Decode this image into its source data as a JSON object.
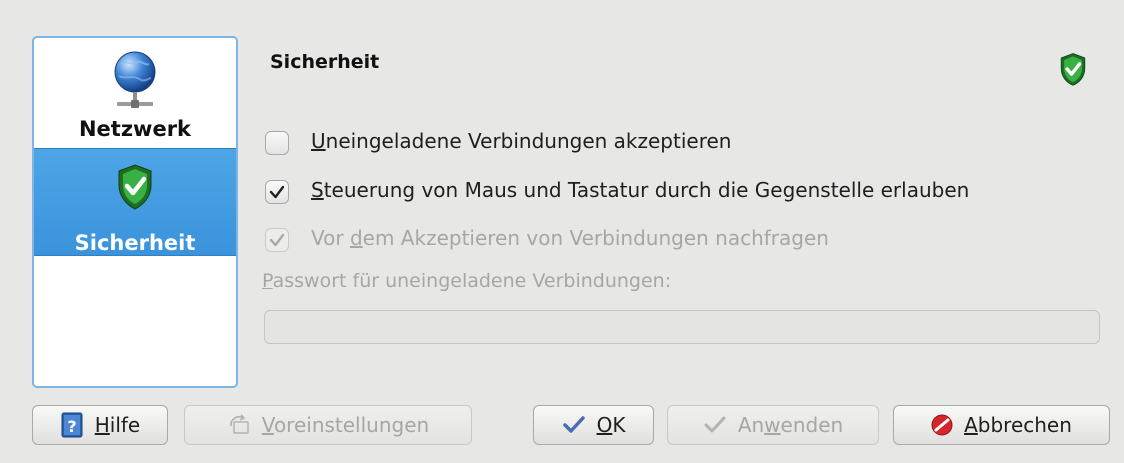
{
  "sidebar": {
    "items": [
      {
        "label": "Netzwerk",
        "icon": "globe-network-icon"
      },
      {
        "label": "Sicherheit",
        "icon": "shield-check-icon",
        "selected": true
      }
    ]
  },
  "page": {
    "title": "Sicherheit",
    "title_icon": "shield-check-icon"
  },
  "options": [
    {
      "accel": "U",
      "rest": "neingeladene Verbindungen akzeptieren",
      "checked": false,
      "enabled": true
    },
    {
      "accel": "S",
      "rest": "teuerung von Maus und Tastatur durch die Gegenstelle erlauben",
      "checked": true,
      "enabled": true
    },
    {
      "pre": "Vor ",
      "accel": "d",
      "rest": "em Akzeptieren von Verbindungen nachfragen",
      "checked": true,
      "enabled": false
    }
  ],
  "password": {
    "accel": "P",
    "rest": "asswort für uneingeladene Verbindungen:",
    "value": "",
    "enabled": false
  },
  "buttons": {
    "help": {
      "accel": "H",
      "rest": "ilfe",
      "icon": "help-book-icon"
    },
    "defaults": {
      "accel": "V",
      "rest": "oreinstellungen",
      "icon": "reset-icon",
      "enabled": false
    },
    "ok": {
      "accel": "O",
      "rest": "K",
      "icon": "checkmark-icon"
    },
    "apply": {
      "pre": "An",
      "accel": "w",
      "rest": "enden",
      "icon": "checkmark-icon",
      "enabled": false
    },
    "cancel": {
      "accel": "A",
      "rest": "bbrechen",
      "icon": "cancel-icon"
    }
  },
  "colors": {
    "accent": "#3a93dc",
    "shield_green": "#2fa33a",
    "cancel_red": "#d6262b"
  }
}
